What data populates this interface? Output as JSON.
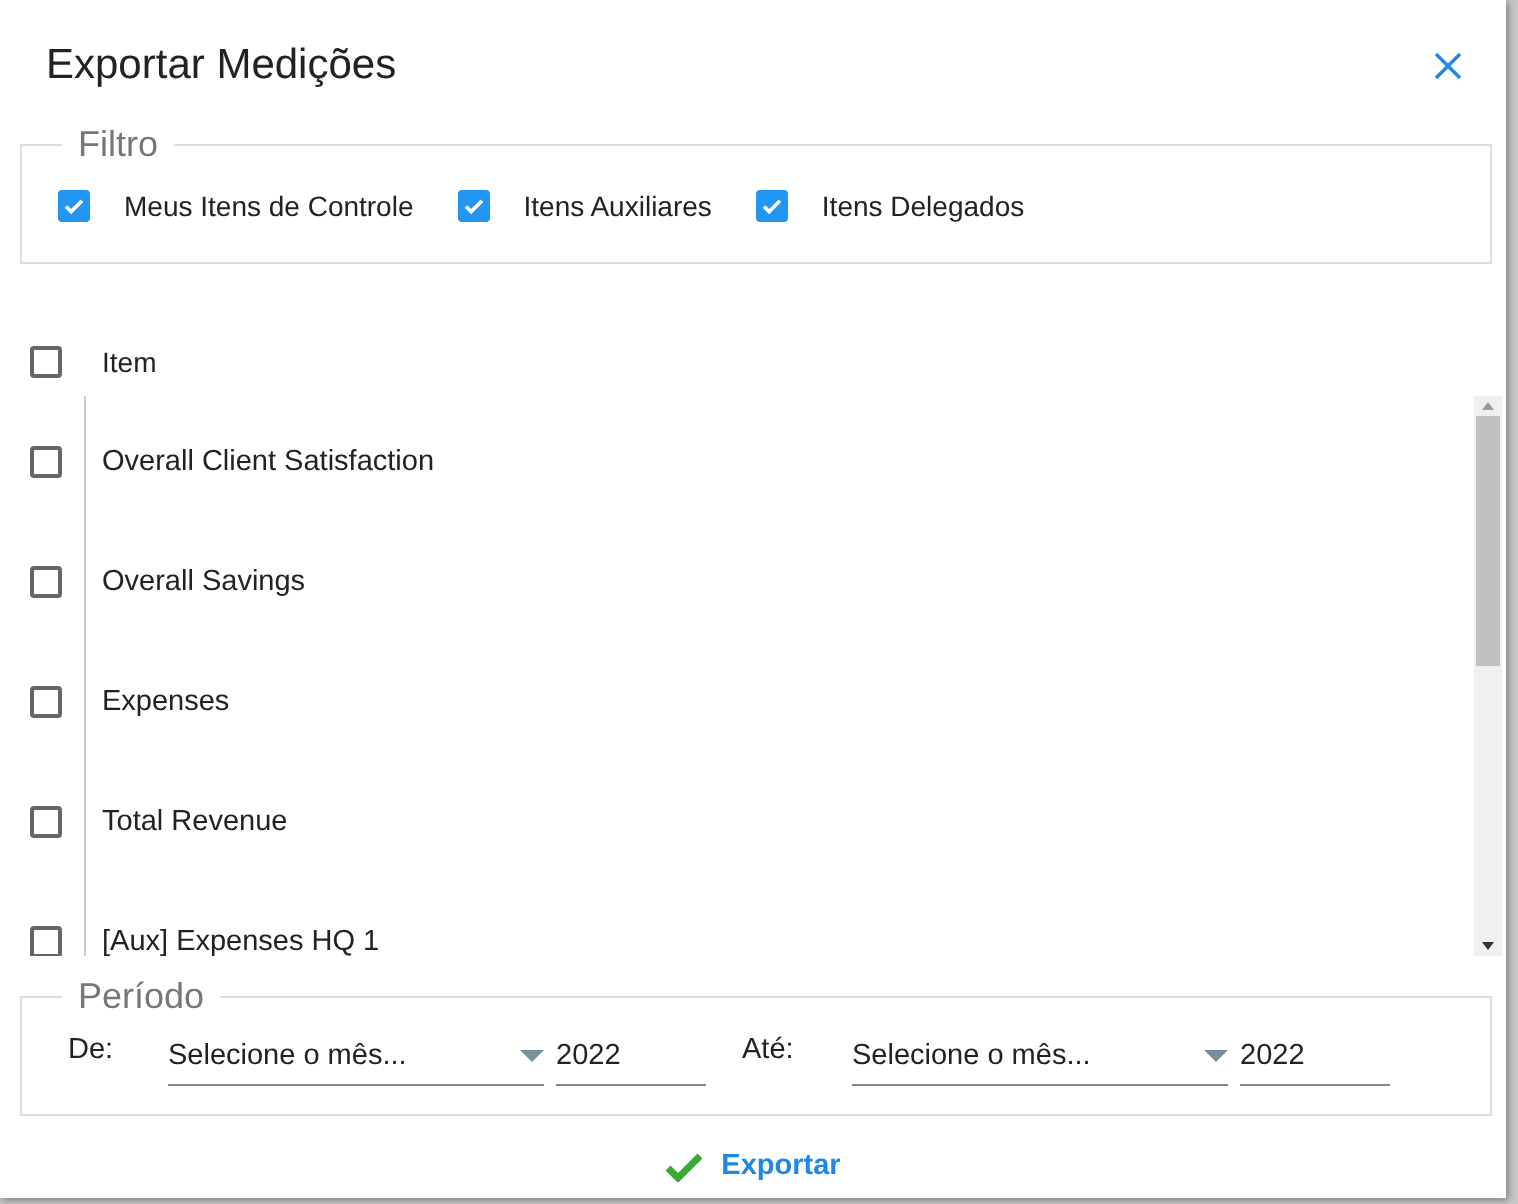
{
  "dialog": {
    "title": "Exportar Medições"
  },
  "filter": {
    "legend": "Filtro",
    "options": [
      {
        "label": "Meus Itens de Controle",
        "checked": true
      },
      {
        "label": "Itens Auxiliares",
        "checked": true
      },
      {
        "label": "Itens Delegados",
        "checked": true
      }
    ]
  },
  "table": {
    "header": {
      "label": "Item",
      "checked": false
    },
    "rows": [
      {
        "label": "Overall Client Satisfaction",
        "checked": false
      },
      {
        "label": "Overall Savings",
        "checked": false
      },
      {
        "label": "Expenses",
        "checked": false
      },
      {
        "label": "Total Revenue",
        "checked": false
      },
      {
        "label": "[Aux] Expenses HQ 1",
        "checked": false
      }
    ]
  },
  "period": {
    "legend": "Período",
    "ranges": [
      {
        "label": "De:",
        "month_placeholder": "Selecione o mês...",
        "year": "2022"
      },
      {
        "label": "Até:",
        "month_placeholder": "Selecione o mês...",
        "year": "2022"
      }
    ]
  },
  "export_button": "Exportar"
}
